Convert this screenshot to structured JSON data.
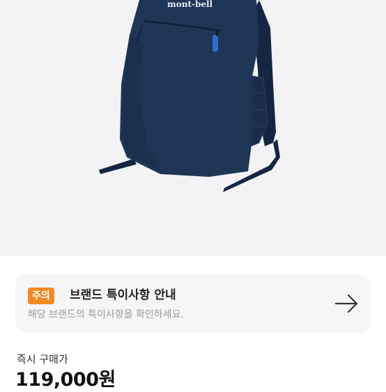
{
  "product_image": {
    "brand_logo_text": "mont-bell",
    "colors": {
      "bag": "#1f3556",
      "bag_dark": "#142642",
      "zip_pull": "#2f6fd1",
      "background": "#f3f3f5"
    }
  },
  "notice": {
    "badge": "주의",
    "title": "브랜드 특이사항 안내",
    "description": "해당 브랜드의 특이사항을 확인하세요.",
    "icon": "arrow-right-icon",
    "badge_color": "#f08a24"
  },
  "price": {
    "label": "즉시 구매가",
    "value": "119,000원"
  }
}
